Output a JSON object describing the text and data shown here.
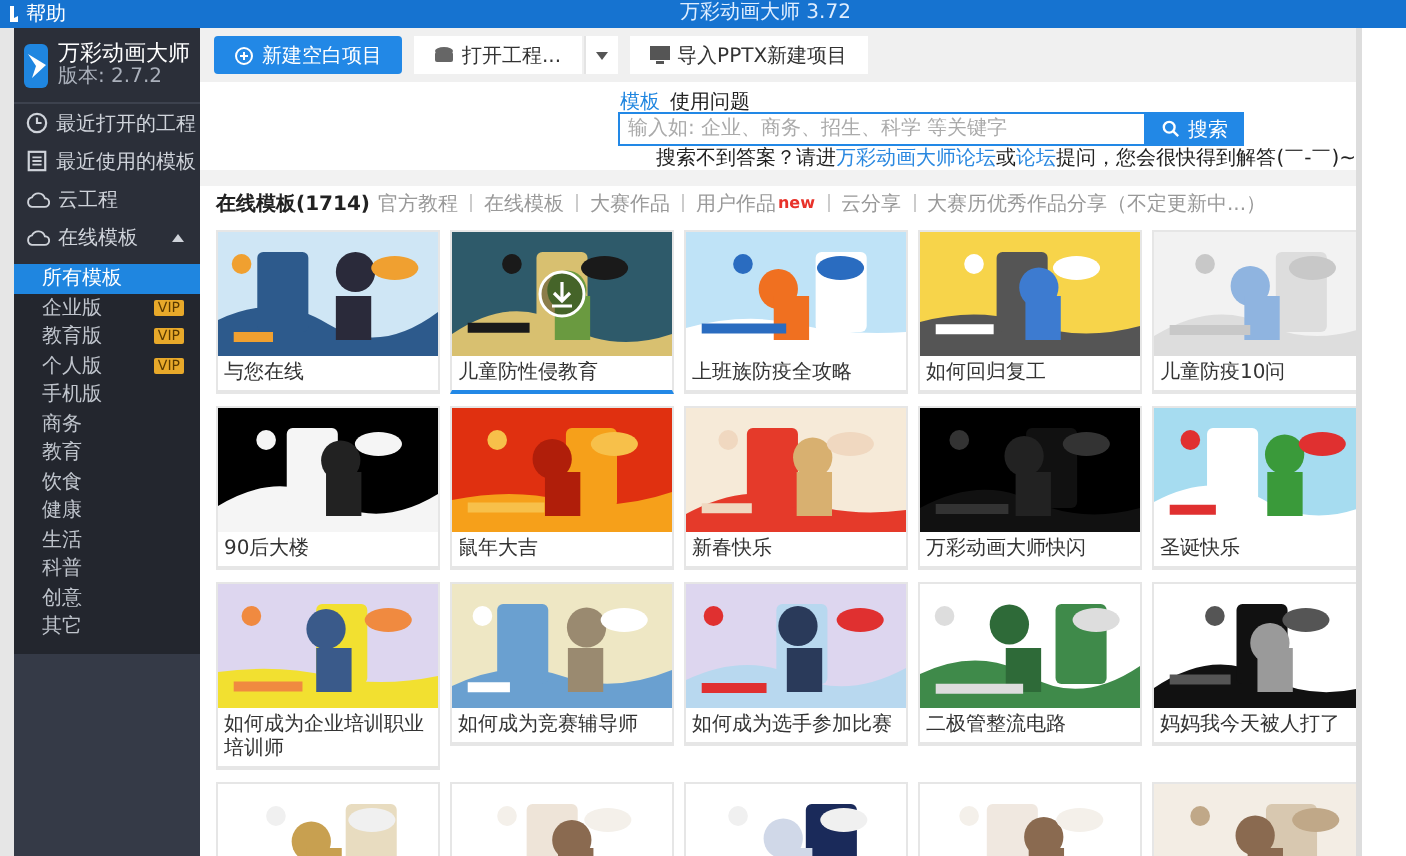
{
  "title_bar": {
    "menu": "帮助",
    "title": "万彩动画大师 3.72"
  },
  "sidebar": {
    "app_name": "万彩动画大师",
    "version": "版本: 2.7.2",
    "items": [
      {
        "label": "最近打开的工程",
        "kind": "clock",
        "selected": false
      },
      {
        "label": "最近使用的模板",
        "kind": "document",
        "selected": false
      },
      {
        "label": "云工程",
        "kind": "cloud",
        "selected": false
      },
      {
        "label": "在线模板",
        "kind": "cloud",
        "selected": false,
        "expanded": true,
        "children": [
          {
            "label": "所有模板",
            "selected": true
          },
          {
            "label": "企业版",
            "badge": "VIP",
            "selected": false
          },
          {
            "label": "教育版",
            "badge": "VIP",
            "selected": false
          },
          {
            "label": "个人版",
            "badge": "VIP",
            "selected": false
          },
          {
            "label": "手机版",
            "selected": false
          },
          {
            "label": "商务",
            "selected": false
          },
          {
            "label": "教育",
            "selected": false
          },
          {
            "label": "饮食",
            "selected": false
          },
          {
            "label": "健康",
            "selected": false
          },
          {
            "label": "生活",
            "selected": false
          },
          {
            "label": "科普",
            "selected": false
          },
          {
            "label": "创意",
            "selected": false
          },
          {
            "label": "其它",
            "selected": false
          }
        ]
      }
    ]
  },
  "toolbar": {
    "buttons": [
      {
        "label": "新建空白项目",
        "kind": "primary"
      },
      {
        "label": "打开工程...",
        "kind": "split"
      },
      {
        "label": "导入PPTX新建项目",
        "kind": "normal"
      }
    ]
  },
  "search": {
    "modes": [
      {
        "label": "模板",
        "selected": true
      },
      {
        "label": "使用问题",
        "selected": false
      }
    ],
    "placeholder": "输入如: 企业、商务、招生、科学 等关键字",
    "button": "搜索",
    "hint": [
      {
        "kind": "text",
        "text": "搜索不到答案？请进"
      },
      {
        "kind": "link",
        "text": "万彩动画大师论坛"
      },
      {
        "kind": "text",
        "text": "或"
      },
      {
        "kind": "link",
        "text": "论坛"
      },
      {
        "kind": "text",
        "text": "提问，您会很快得到解答(￣-￣)~"
      }
    ]
  },
  "filter": {
    "heading": "在线模板(1714)",
    "tabs": [
      {
        "label": "官方教程"
      },
      {
        "label": "在线模板"
      },
      {
        "label": "大赛作品"
      },
      {
        "label": "用户作品",
        "badge": "new"
      },
      {
        "label": "云分享"
      },
      {
        "label": "大赛历优秀作品分享（不定更新中...）"
      }
    ]
  },
  "cards": [
    {
      "label": "与您在线",
      "selected": false
    },
    {
      "label": "儿童防性侵教育",
      "selected": true
    },
    {
      "label": "上班族防疫全攻略",
      "selected": false
    },
    {
      "label": "如何回归复工",
      "selected": false
    },
    {
      "label": "儿童防疫10问",
      "selected": false
    },
    {
      "label": "90后大楼",
      "selected": false
    },
    {
      "label": "鼠年大吉",
      "selected": false
    },
    {
      "label": "新春快乐",
      "selected": false
    },
    {
      "label": "万彩动画大师快闪",
      "selected": false
    },
    {
      "label": "圣诞快乐",
      "selected": false
    },
    {
      "label": "如何成为企业培训职业培训师",
      "selected": false
    },
    {
      "label": "如何成为竞赛辅导师",
      "selected": false
    },
    {
      "label": "如何成为选手参加比赛",
      "selected": false
    },
    {
      "label": "二极管整流电路",
      "selected": false
    },
    {
      "label": "妈妈我今天被人打了",
      "selected": false
    },
    {
      "selected": false
    },
    {
      "selected": false
    },
    {
      "selected": false
    },
    {
      "selected": false
    },
    {
      "selected": false
    }
  ]
}
